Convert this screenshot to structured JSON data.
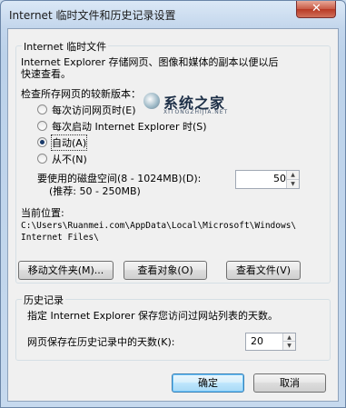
{
  "window": {
    "title": "Internet 临时文件和历史记录设置",
    "close_label": "✕"
  },
  "temp_files": {
    "group_title": "Internet 临时文件",
    "description_line1": "Internet Explorer 存储网页、图像和媒体的副本以便以后",
    "description_line2": "快速查看。",
    "check_label": "检查所存网页的较新版本：",
    "options": [
      {
        "label": "每次访问网页时(E)",
        "selected": false
      },
      {
        "label": "每次启动 Internet Explorer 时(S)",
        "selected": false
      },
      {
        "label": "自动(A)",
        "selected": true
      },
      {
        "label": "从不(N)",
        "selected": false
      }
    ],
    "disk_space_label": "要使用的磁盘空间(8 - 1024MB)(D):",
    "disk_space_hint": "(推荐: 50 - 250MB)",
    "disk_space_value": "50",
    "location_label": "当前位置:",
    "location_path_line1": "C:\\Users\\Ruanmei.com\\AppData\\Local\\Microsoft\\Windows\\",
    "location_path_line2": "Internet Files\\",
    "buttons": {
      "move_folder": "移动文件夹(M)...",
      "view_objects": "查看对象(O)",
      "view_files": "查看文件(V)"
    }
  },
  "history": {
    "group_title": "历史记录",
    "description": "指定 Internet Explorer 保存您访问过网站列表的天数。",
    "days_label": "网页保存在历史记录中的天数(K):",
    "days_value": "20"
  },
  "footer": {
    "ok": "确定",
    "cancel": "取消"
  },
  "watermark": {
    "text": "系统之家",
    "sub": "XITONGZHIJIA.NET"
  }
}
